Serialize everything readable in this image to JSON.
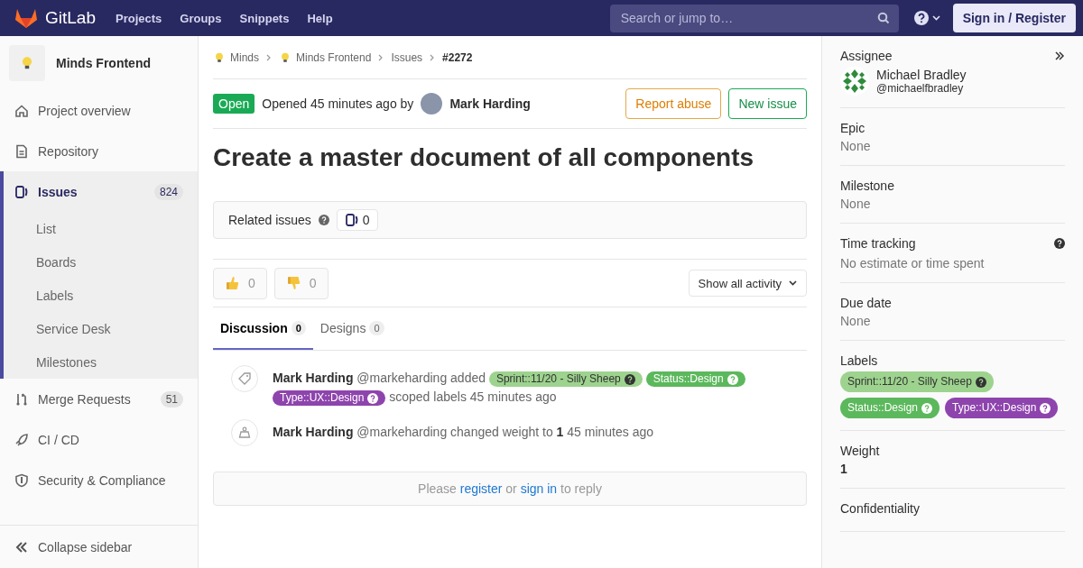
{
  "header": {
    "logo_text": "GitLab",
    "nav": [
      "Projects",
      "Groups",
      "Snippets",
      "Help"
    ],
    "search": {
      "placeholder": "Search or jump to…"
    },
    "sign_in": "Sign in / Register"
  },
  "sidebar": {
    "project": "Minds Frontend",
    "items": [
      {
        "label": "Project overview",
        "kind": "home",
        "selected": false
      },
      {
        "label": "Repository",
        "kind": "doc",
        "selected": false
      },
      {
        "label": "Issues",
        "kind": "issues",
        "count": "824",
        "selected": true,
        "children": [
          {
            "label": "List"
          },
          {
            "label": "Boards"
          },
          {
            "label": "Labels"
          },
          {
            "label": "Service Desk"
          },
          {
            "label": "Milestones"
          }
        ]
      },
      {
        "label": "Merge Requests",
        "kind": "merge",
        "count": "51",
        "selected": false
      },
      {
        "label": "CI / CD",
        "kind": "rocket",
        "selected": false
      },
      {
        "label": "Security & Compliance",
        "kind": "shield",
        "selected": false
      }
    ],
    "collapse": "Collapse sidebar"
  },
  "breadcrumbs": [
    {
      "label": "Minds",
      "kind": "group"
    },
    {
      "label": "Minds Frontend",
      "kind": "group"
    },
    {
      "label": "Issues",
      "kind": "link"
    },
    {
      "label": "#2272",
      "kind": "current"
    }
  ],
  "issue": {
    "status": "Open",
    "opened": "Opened 45 minutes ago by",
    "author": "Mark Harding",
    "actions": [
      {
        "label": "Report abuse",
        "kind": "warning"
      },
      {
        "label": "New issue",
        "kind": "success"
      }
    ],
    "title": "Create a master document of all components"
  },
  "related": {
    "label": "Related issues",
    "count": "0"
  },
  "awards": [
    {
      "kind": "thumbsup",
      "count": "0"
    },
    {
      "kind": "thumbsdown",
      "count": "0"
    }
  ],
  "filter": "Show all activity",
  "tabs": [
    {
      "label": "Discussion",
      "count": "0",
      "selected": true
    },
    {
      "label": "Designs",
      "count": "0",
      "selected": false
    }
  ],
  "notes": [
    {
      "kind": "label",
      "author": "Mark Harding",
      "handle": "@markeharding",
      "action": "added",
      "labels": [
        {
          "text": "Sprint::11/20 - Silly Sheep",
          "color": "#9dd38e"
        },
        {
          "text": "Status::Design",
          "color": "#5cb85c"
        },
        {
          "text": "Type::UX::Design",
          "color": "#8e44ad"
        }
      ],
      "after": "scoped labels 45 minutes ago"
    },
    {
      "kind": "weight",
      "author": "Mark Harding",
      "handle": "@markeharding",
      "text": "changed weight to **1** 45 minutes ago"
    }
  ],
  "reply": [
    {
      "text": "Please",
      "link": false
    },
    {
      "text": "register",
      "link": true
    },
    {
      "text": "or",
      "link": false
    },
    {
      "text": "sign in",
      "link": true
    },
    {
      "text": "to reply",
      "link": false
    }
  ],
  "right": [
    {
      "kind": "assignee",
      "title": "Assignee",
      "name": "Michael Bradley",
      "username": "@michaelfbradley"
    },
    {
      "kind": "value",
      "title": "Epic",
      "value": "None"
    },
    {
      "kind": "value",
      "title": "Milestone",
      "value": "None"
    },
    {
      "kind": "help",
      "title": "Time tracking",
      "value": "No estimate or time spent"
    },
    {
      "kind": "value",
      "title": "Due date",
      "value": "None"
    },
    {
      "kind": "labels",
      "title": "Labels",
      "labels": [
        {
          "text": "Sprint::11/20 - Silly Sheep",
          "color": "#9dd38e"
        },
        {
          "text": "Status::Design",
          "color": "#5cb85c"
        },
        {
          "text": "Type::UX::Design",
          "color": "#8e44ad"
        }
      ]
    },
    {
      "kind": "bold",
      "title": "Weight",
      "value": "1"
    },
    {
      "kind": "title",
      "title": "Confidentiality"
    }
  ]
}
